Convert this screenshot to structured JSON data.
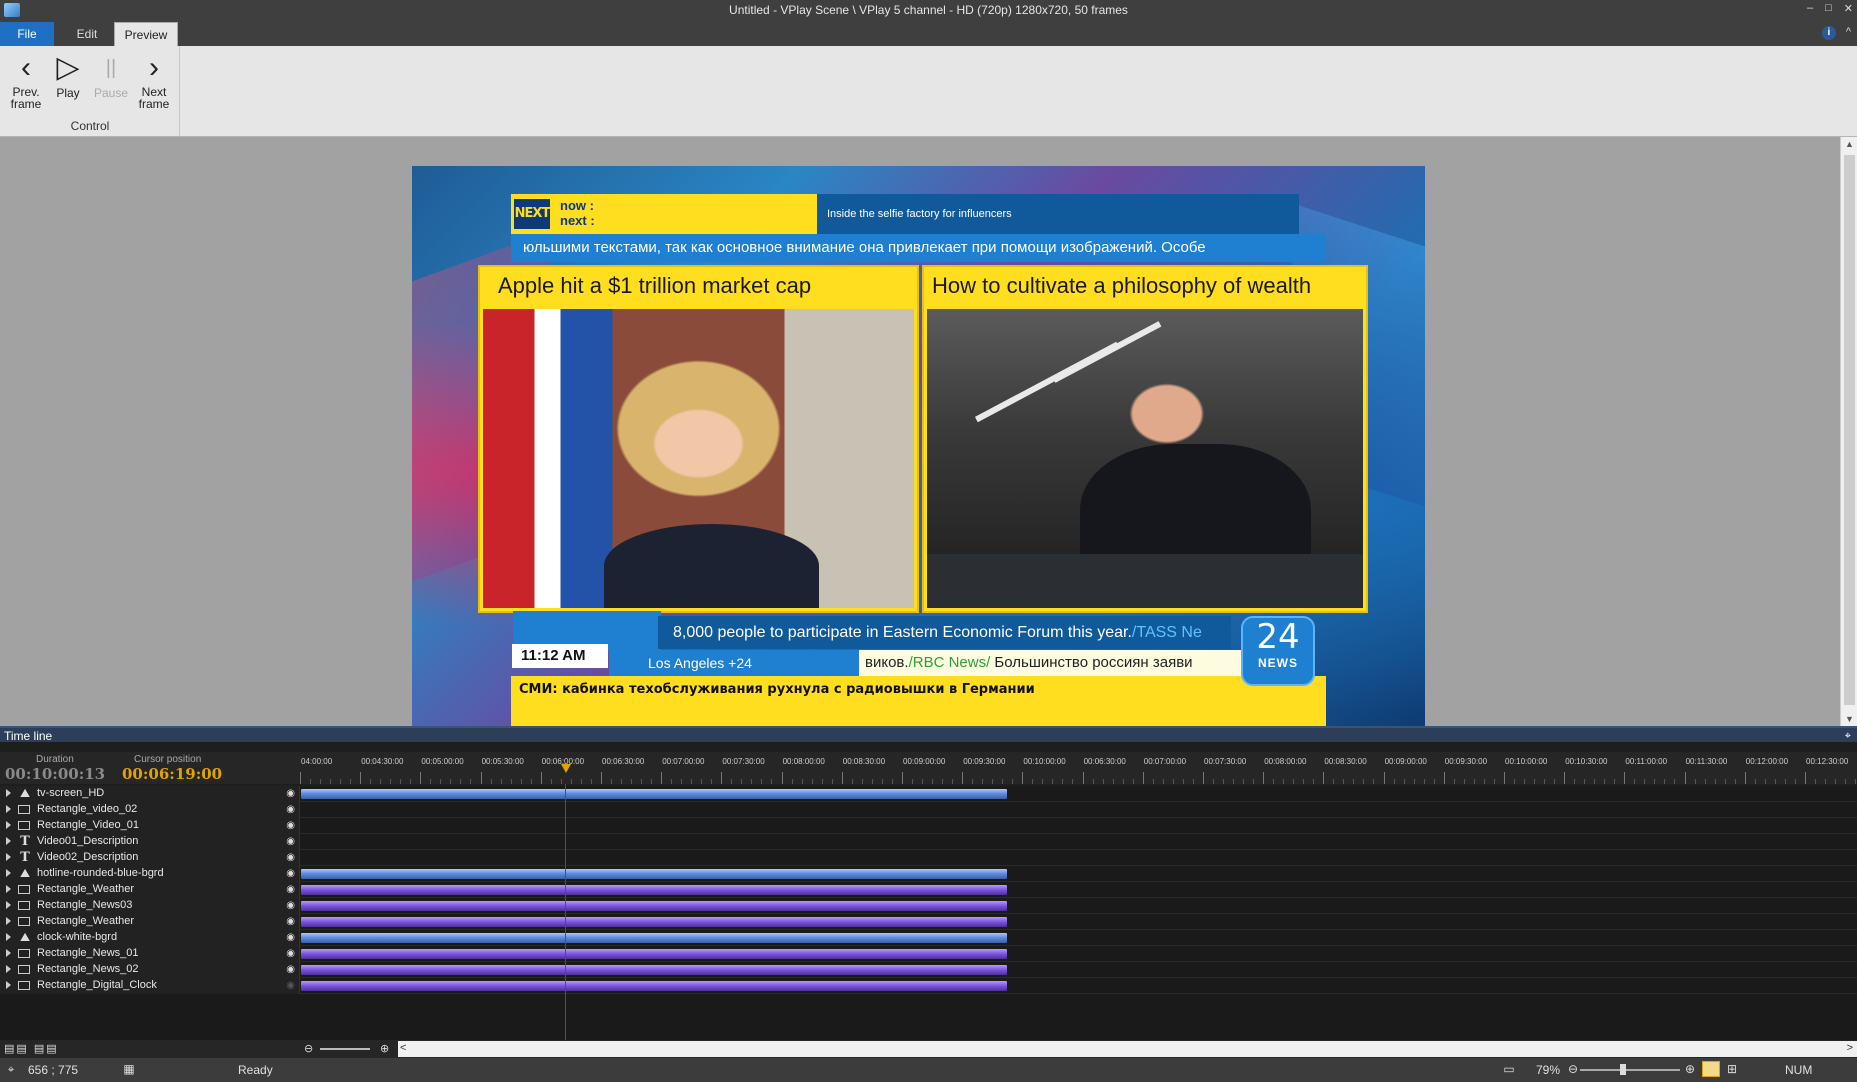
{
  "window": {
    "title": "Untitled  -  VPlay Scene \\ VPlay 5 channel - HD (720p) 1280x720, 50 frames",
    "min": "–",
    "max": "□",
    "close": "✕"
  },
  "menu": {
    "tabs": [
      "File",
      "Edit",
      "Preview"
    ],
    "info": "i",
    "collapse": "^"
  },
  "ribbon": {
    "group_label": "Control",
    "buttons": [
      {
        "label": "Prev.\nframe",
        "icon": "chevron-left-icon",
        "glyph": "‹",
        "enabled": true
      },
      {
        "label": "Play",
        "icon": "play-icon",
        "glyph": "▷",
        "enabled": true
      },
      {
        "label": "Pause",
        "icon": "pause-icon",
        "glyph": "||",
        "enabled": false
      },
      {
        "label": "Next\nframe",
        "icon": "chevron-right-icon",
        "glyph": "›",
        "enabled": true
      }
    ]
  },
  "scene": {
    "next_logo": "NEXT",
    "now_label": "now :",
    "next_label": "next :",
    "next_title": "Inside the selfie factory for influencers",
    "ticker_top": "юльшими текстами, так как основное внимание она привлекает при помощи изображений. Особе",
    "headline_left": "Apple hit a $1 trillion market cap",
    "headline_right": "How to cultivate a philosophy of wealth",
    "headline_bottom": "8,000 people to participate in Eastern Economic Forum this year.",
    "headline_bottom_source": "/TASS Nе",
    "clock": "11:12 AM",
    "weather": "Los Angeles +24",
    "ticker_ru_pre": "виков.",
    "ticker_ru_source": "/RBC News/",
    "ticker_ru_post": " Большинство россиян заяви",
    "logo_number": "24",
    "logo_text": "NEWS",
    "smi": "СМИ: кабинка техобслуживания рухнула с радиовышки в Германии"
  },
  "timeline": {
    "title": "Time line",
    "pin": "⌖",
    "duration_label": "Duration",
    "duration": "00:10:00:13",
    "cursor_label": "Cursor position",
    "cursor": "00:06:19:00",
    "ticks": [
      "04:00:00",
      "00:04:30:00",
      "00:05:00:00",
      "00:05:30:00",
      "00:06:00:00",
      "00:06:30:00",
      "00:07:00:00",
      "00:07:30:00",
      "00:08:00:00",
      "00:08:30:00",
      "00:09:00:00",
      "00:09:30:00",
      "00:10:00:00",
      "00:06:30:00",
      "00:07:00:00",
      "00:07:30:00",
      "00:08:00:00",
      "00:08:30:00",
      "00:09:00:00",
      "00:09:30:00",
      "00:10:00:00",
      "00:10:30:00",
      "00:11:00:00",
      "00:11:30:00",
      "00:12:00:00",
      "00:12:30:00"
    ],
    "tracks": [
      {
        "name": "tv-screen_HD",
        "type": "img",
        "visible": true,
        "clip": "blue"
      },
      {
        "name": "Rectangle_video_02",
        "type": "rect",
        "visible": true,
        "clip": ""
      },
      {
        "name": "Rectangle_Video_01",
        "type": "rect",
        "visible": true,
        "clip": ""
      },
      {
        "name": "Video01_Description",
        "type": "text",
        "visible": true,
        "clip": ""
      },
      {
        "name": "Video02_Description",
        "type": "text",
        "visible": true,
        "clip": ""
      },
      {
        "name": "hotline-rounded-blue-bgrd",
        "type": "img",
        "visible": true,
        "clip": "blue"
      },
      {
        "name": "Rectangle_Weather",
        "type": "rect",
        "visible": true,
        "clip": "purple"
      },
      {
        "name": "Rectangle_News03",
        "type": "rect",
        "visible": true,
        "clip": "purple"
      },
      {
        "name": "Rectangle_Weather",
        "type": "rect",
        "visible": true,
        "clip": "purple"
      },
      {
        "name": "clock-white-bgrd",
        "type": "img",
        "visible": true,
        "clip": "blue"
      },
      {
        "name": "Rectangle_News_01",
        "type": "rect",
        "visible": true,
        "clip": "purple"
      },
      {
        "name": "Rectangle_News_02",
        "type": "rect",
        "visible": true,
        "clip": "purple"
      },
      {
        "name": "Rectangle_Digital_Clock",
        "type": "rect",
        "visible": false,
        "clip": "purple"
      }
    ],
    "layer_icons": "▤▤ ▤▤",
    "zoom_out": "⊖",
    "zoom_in": "⊕",
    "scroll_left": "<",
    "scroll_right": ">"
  },
  "statusbar": {
    "coords": "656 ; 775",
    "status": "Ready",
    "zoom": "79%",
    "num": "NUM",
    "zoom_minus": "⊖",
    "zoom_plus": "⊕"
  },
  "colors": {
    "accent_blue": "#1f6fc5",
    "scene_yellow": "#ffdd1f",
    "scene_blue": "#105a9c",
    "cursor_orange": "#e2a400",
    "playhead_red": "#c0202a"
  }
}
